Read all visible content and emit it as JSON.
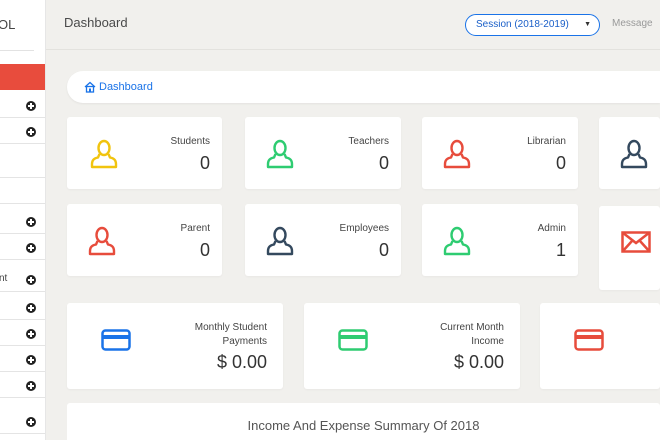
{
  "sidebar": {
    "brand_text": "OL",
    "partial_item_text": "nt"
  },
  "header": {
    "title": "Dashboard",
    "session": "Session (2018-2019)",
    "message": "Message"
  },
  "breadcrumb": {
    "label": "Dashboard"
  },
  "cards": [
    {
      "label": "Students",
      "count": "0",
      "icon": "user-icon",
      "color": "#f1c40f"
    },
    {
      "label": "Teachers",
      "count": "0",
      "icon": "user-icon",
      "color": "#2ecc71"
    },
    {
      "label": "Librarian",
      "count": "0",
      "icon": "user-icon",
      "color": "#e74c3c"
    },
    {
      "label": "",
      "count": "",
      "icon": "user-icon",
      "color": "#34495e"
    },
    {
      "label": "Parent",
      "count": "0",
      "icon": "user-icon",
      "color": "#e74c3c"
    },
    {
      "label": "Employees",
      "count": "0",
      "icon": "user-icon",
      "color": "#34495e"
    },
    {
      "label": "Admin",
      "count": "1",
      "icon": "user-icon",
      "color": "#2ecc71"
    },
    {
      "label": "",
      "count": "",
      "icon": "envelope-icon",
      "color": "#e74c3c"
    }
  ],
  "payments": [
    {
      "label_line1": "Monthly Student",
      "label_line2": "Payments",
      "value": "$ 0.00",
      "icon": "credit-card-icon",
      "color": "#1a73e8"
    },
    {
      "label_line1": "Current Month",
      "label_line2": "Income",
      "value": "$ 0.00",
      "icon": "credit-card-icon",
      "color": "#2ecc71"
    },
    {
      "label_line1": "",
      "label_line2": "",
      "value": "",
      "icon": "credit-card-icon",
      "color": "#e74c3c"
    }
  ],
  "summary": {
    "title": "Income And Expense Summary Of 2018"
  }
}
